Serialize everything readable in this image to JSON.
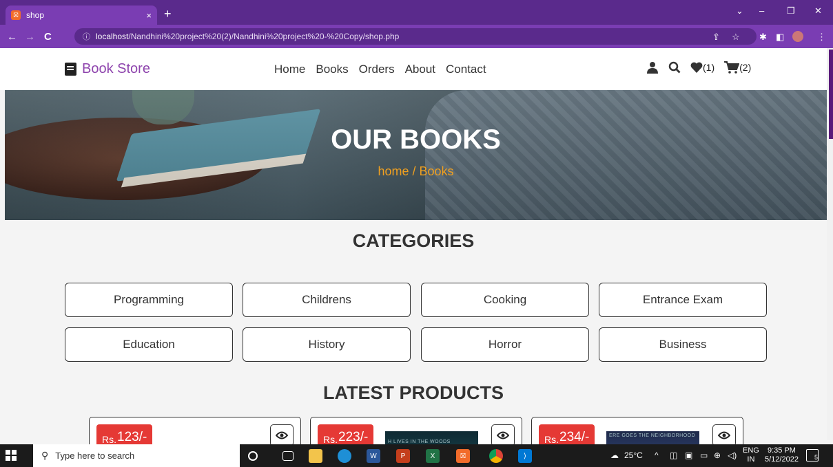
{
  "browser": {
    "tab_title": "shop",
    "tab_close": "×",
    "new_tab": "+",
    "url_host": "localhost",
    "url_path": "/Nandhini%20project%20(2)/Nandhini%20project%20-%20Copy/shop.php",
    "back": "←",
    "forward": "→",
    "reload": "C",
    "info": "ⓘ",
    "window_controls": {
      "dropdown": "⌄",
      "minimize": "–",
      "restore": "❐",
      "close": "✕"
    },
    "extensions": {
      "share": "⇪",
      "star": "☆",
      "puzzle": "✱",
      "sidebar": "◧",
      "menu": "⋮"
    }
  },
  "header": {
    "logo_text": "Book Store",
    "nav": [
      "Home",
      "Books",
      "Orders",
      "About",
      "Contact"
    ],
    "wishlist_count": "(1)",
    "cart_count": "(2)"
  },
  "hero": {
    "title": "OUR BOOKS",
    "breadcrumb": "home / Books"
  },
  "categories": {
    "title": "CATEGORIES",
    "items": [
      "Programming",
      "Childrens",
      "Cooking",
      "Entrance Exam",
      "Education",
      "History",
      "Horror",
      "Business"
    ]
  },
  "products": {
    "title": "LATEST PRODUCTS",
    "items": [
      {
        "price_prefix": "Rs.",
        "price": "123/-",
        "cover_text": ""
      },
      {
        "price_prefix": "Rs.",
        "price": "223/-",
        "cover_text": "H LIVES IN THE WOODS"
      },
      {
        "price_prefix": "Rs.",
        "price": "234/-",
        "cover_text": "ERE GOES THE NEIGHBORHOOD"
      }
    ]
  },
  "taskbar": {
    "search_placeholder": "Type here to search",
    "weather": "25°C",
    "lang_line1": "ENG",
    "lang_line2": "IN",
    "time": "9:35 PM",
    "date": "5/12/2022",
    "notif_count": "5"
  },
  "colors": {
    "brand": "#8e44ad",
    "price_bg": "#e53935",
    "breadcrumb": "#f0a020",
    "browser_frame": "#7a3db3"
  }
}
